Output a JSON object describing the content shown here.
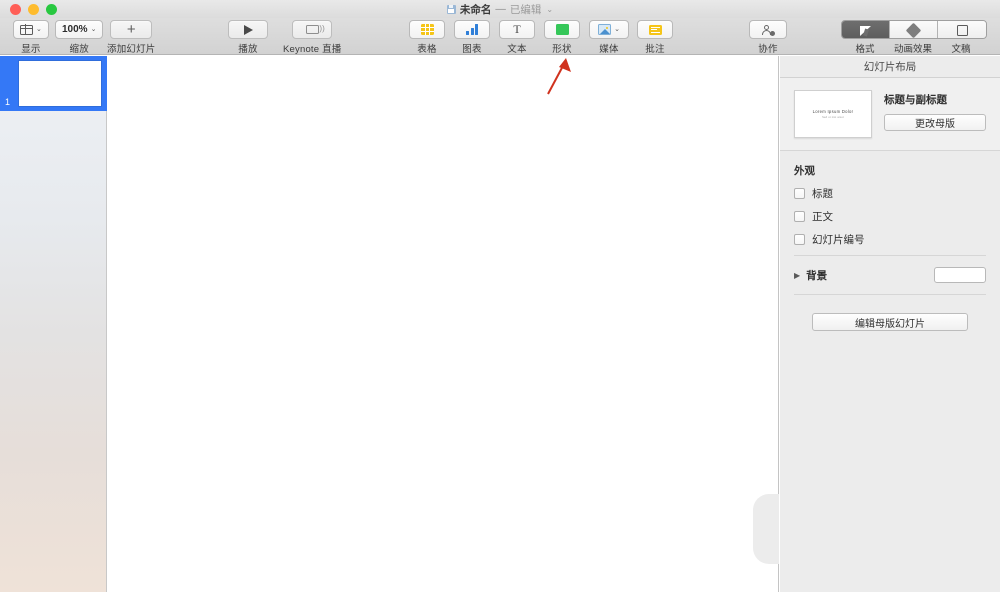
{
  "window": {
    "title_name": "未命名",
    "title_dash": "—",
    "title_state": "已编辑",
    "title_chevron": "⌄",
    "doc_icon": "document-save-icon",
    "traffic_lights": [
      "close-red",
      "minimize-yellow",
      "maximize-green"
    ]
  },
  "toolbar": {
    "left_items": [
      {
        "label": "显示",
        "icon": "view-panes-icon",
        "has_chevron": true
      },
      {
        "label": "缩放",
        "icon": "zoom-value",
        "value": "100%",
        "has_chevron": true
      },
      {
        "label": "添加幻灯片",
        "icon": "plus-icon",
        "has_chevron": false
      }
    ],
    "play_items": [
      {
        "label": "播放",
        "icon": "play-triangle-icon"
      },
      {
        "label": "Keynote 直播",
        "icon": "live-broadcast-icon"
      }
    ],
    "insert_items": [
      {
        "label": "表格",
        "icon": "table-icon",
        "color": "#f5c518"
      },
      {
        "label": "图表",
        "icon": "bar-chart-icon",
        "color": "#2f7fd8"
      },
      {
        "label": "文本",
        "icon": "text-T-icon"
      },
      {
        "label": "形状",
        "icon": "shape-square-icon",
        "color": "#35c759"
      },
      {
        "label": "媒体",
        "icon": "media-image-icon",
        "has_chevron": true
      },
      {
        "label": "批注",
        "icon": "comment-note-icon",
        "color": "#f5c518"
      }
    ],
    "collaborate": {
      "label": "协作",
      "icon": "collaborate-person-gear-icon"
    },
    "segments": [
      {
        "label": "格式",
        "icon": "format-brush-icon",
        "active": true
      },
      {
        "label": "动画效果",
        "icon": "animate-diamond-icon",
        "active": false
      },
      {
        "label": "文稿",
        "icon": "document-square-icon",
        "active": false
      }
    ]
  },
  "sidebar": {
    "slides": [
      {
        "number": "1",
        "selected": true
      }
    ],
    "selection_color": "#3478f6"
  },
  "inspector": {
    "header": "幻灯片布局",
    "layout": {
      "master_thumb_title": "Lorem Ipsum Dolor",
      "master_thumb_subtitle": "Sed ut nisi amet",
      "layout_name": "标题与副标题",
      "change_master_button": "更改母版"
    },
    "appearance": {
      "section_title": "外观",
      "checkboxes": [
        {
          "label": "标题",
          "checked": false
        },
        {
          "label": "正文",
          "checked": false
        },
        {
          "label": "幻灯片编号",
          "checked": false
        }
      ]
    },
    "background": {
      "disclosure": "▶",
      "label": "背景",
      "swatch_color": "#ffffff"
    },
    "edit_master_button": "编辑母版幻灯片"
  },
  "annotation": {
    "arrow_color": "#d0321e",
    "points_to": "形状"
  }
}
